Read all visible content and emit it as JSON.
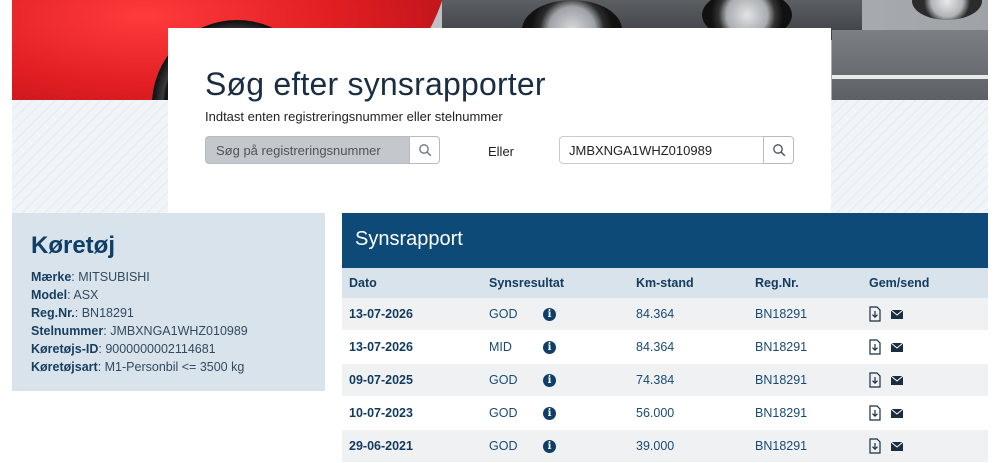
{
  "search": {
    "title": "Søg efter synsrapporter",
    "subtitle": "Indtast enten registreringsnummer eller stelnummer",
    "reg_placeholder": "Søg på registreringsnummer",
    "or_label": "Eller",
    "vin_value": "JMBXNGA1WHZ010989"
  },
  "vehicle": {
    "heading": "Køretøj",
    "fields": [
      {
        "label": "Mærke",
        "value": "MITSUBISHI"
      },
      {
        "label": "Model",
        "value": "ASX"
      },
      {
        "label": "Reg.Nr.",
        "value": "BN18291"
      },
      {
        "label": "Stelnummer",
        "value": "JMBXNGA1WHZ010989"
      },
      {
        "label": "Køretøjs-ID",
        "value": "9000000002114681"
      },
      {
        "label": "Køretøjsart",
        "value": "M1-Personbil <= 3500 kg"
      }
    ]
  },
  "report": {
    "heading": "Synsrapport",
    "columns": [
      "Dato",
      "Synsresultat",
      "Km-stand",
      "Reg.Nr.",
      "Gem/send"
    ],
    "rows": [
      {
        "date": "13-07-2026",
        "result": "GOD",
        "km": "84.364",
        "reg": "BN18291"
      },
      {
        "date": "13-07-2026",
        "result": "MID",
        "km": "84.364",
        "reg": "BN18291"
      },
      {
        "date": "09-07-2025",
        "result": "GOD",
        "km": "74.384",
        "reg": "BN18291"
      },
      {
        "date": "10-07-2023",
        "result": "GOD",
        "km": "56.000",
        "reg": "BN18291"
      },
      {
        "date": "29-06-2021",
        "result": "GOD",
        "km": "39.000",
        "reg": "BN18291"
      }
    ]
  },
  "icons": {
    "search": "search-icon",
    "info": "info-icon",
    "save": "download-file-icon",
    "send": "envelope-icon"
  },
  "colors": {
    "primary": "#0d4a78",
    "panel": "#d8e3ec",
    "text": "#1b3a57"
  }
}
